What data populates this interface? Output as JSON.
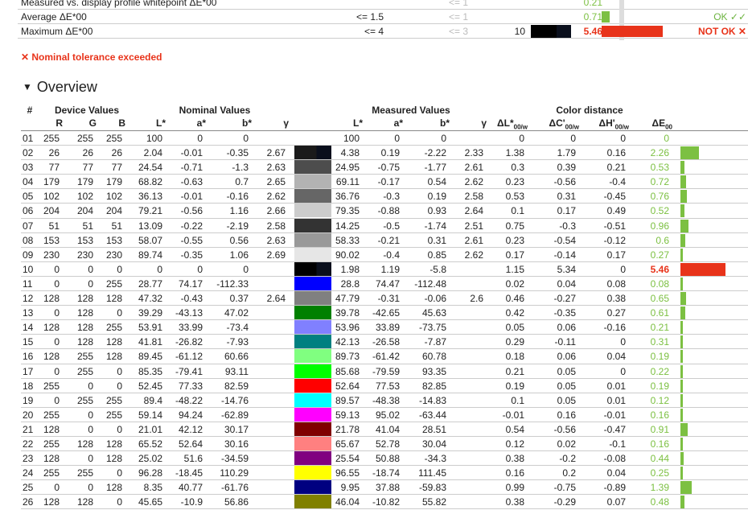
{
  "summary": [
    {
      "label": "Measured vs. display profile whitepoint ΔE*00",
      "nominal": "",
      "recommended": "<= 1",
      "value": "0.21",
      "status": "",
      "bad": false,
      "bar": 0,
      "sw_value": "",
      "sw_color": ""
    },
    {
      "label": "Average ΔE*00",
      "nominal": "<= 1.5",
      "recommended": "<= 1",
      "value": "0.71",
      "status": "OK ✓✓",
      "bad": false,
      "bar": 0.71,
      "sw_value": "",
      "sw_color": ""
    },
    {
      "label": "Maximum ΔE*00",
      "nominal": "<= 4",
      "recommended": "<= 3",
      "value": "5.46",
      "status": "NOT OK ✕",
      "bad": true,
      "bar": 5.46,
      "sw_value": "10",
      "sw_color": "#000000"
    }
  ],
  "warning": "✕ Nominal tolerance exceeded",
  "overview_title": "Overview",
  "headers": {
    "group": [
      "#",
      "Device Values",
      "Nominal Values",
      "Measured Values",
      "Color distance"
    ],
    "cols": [
      "R",
      "G",
      "B",
      "L*",
      "a*",
      "b*",
      "γ",
      "L*",
      "a*",
      "b*",
      "γ",
      "ΔL*00/w",
      "ΔC'00/w",
      "ΔH'00/w",
      "ΔE00"
    ]
  },
  "colors": {
    "good": "#7cc042",
    "bad": "#e8331a"
  },
  "rows": [
    {
      "id": "01",
      "r": "255",
      "g": "255",
      "b": "255",
      "nl": "100",
      "na": "0",
      "nb": "0",
      "ng": "",
      "ml": "100",
      "ma": "0",
      "mb": "0",
      "mg": "",
      "dl": "0",
      "dc": "0",
      "dh": "0",
      "de": "0",
      "color": "#ffffff"
    },
    {
      "id": "02",
      "r": "26",
      "g": "26",
      "b": "26",
      "nl": "2.04",
      "na": "-0.01",
      "nb": "-0.35",
      "ng": "2.67",
      "ml": "4.38",
      "ma": "0.19",
      "mb": "-2.22",
      "mg": "2.33",
      "dl": "1.38",
      "dc": "1.79",
      "dh": "0.16",
      "de": "2.26",
      "color": "#1a1a1a"
    },
    {
      "id": "03",
      "r": "77",
      "g": "77",
      "b": "77",
      "nl": "24.54",
      "na": "-0.71",
      "nb": "-1.3",
      "ng": "2.63",
      "ml": "24.95",
      "ma": "-0.75",
      "mb": "-1.77",
      "mg": "2.61",
      "dl": "0.3",
      "dc": "0.39",
      "dh": "0.21",
      "de": "0.53",
      "color": "#4d4d4d"
    },
    {
      "id": "04",
      "r": "179",
      "g": "179",
      "b": "179",
      "nl": "68.82",
      "na": "-0.63",
      "nb": "0.7",
      "ng": "2.65",
      "ml": "69.11",
      "ma": "-0.17",
      "mb": "0.54",
      "mg": "2.62",
      "dl": "0.23",
      "dc": "-0.56",
      "dh": "-0.4",
      "de": "0.72",
      "color": "#b3b3b3"
    },
    {
      "id": "05",
      "r": "102",
      "g": "102",
      "b": "102",
      "nl": "36.13",
      "na": "-0.01",
      "nb": "-0.16",
      "ng": "2.62",
      "ml": "36.76",
      "ma": "-0.3",
      "mb": "0.19",
      "mg": "2.58",
      "dl": "0.53",
      "dc": "0.31",
      "dh": "-0.45",
      "de": "0.76",
      "color": "#666666"
    },
    {
      "id": "06",
      "r": "204",
      "g": "204",
      "b": "204",
      "nl": "79.21",
      "na": "-0.56",
      "nb": "1.16",
      "ng": "2.66",
      "ml": "79.35",
      "ma": "-0.88",
      "mb": "0.93",
      "mg": "2.64",
      "dl": "0.1",
      "dc": "0.17",
      "dh": "0.49",
      "de": "0.52",
      "color": "#cccccc"
    },
    {
      "id": "07",
      "r": "51",
      "g": "51",
      "b": "51",
      "nl": "13.09",
      "na": "-0.22",
      "nb": "-2.19",
      "ng": "2.58",
      "ml": "14.25",
      "ma": "-0.5",
      "mb": "-1.74",
      "mg": "2.51",
      "dl": "0.75",
      "dc": "-0.3",
      "dh": "-0.51",
      "de": "0.96",
      "color": "#333333"
    },
    {
      "id": "08",
      "r": "153",
      "g": "153",
      "b": "153",
      "nl": "58.07",
      "na": "-0.55",
      "nb": "0.56",
      "ng": "2.63",
      "ml": "58.33",
      "ma": "-0.21",
      "mb": "0.31",
      "mg": "2.61",
      "dl": "0.23",
      "dc": "-0.54",
      "dh": "-0.12",
      "de": "0.6",
      "color": "#999999"
    },
    {
      "id": "09",
      "r": "230",
      "g": "230",
      "b": "230",
      "nl": "89.74",
      "na": "-0.35",
      "nb": "1.06",
      "ng": "2.69",
      "ml": "90.02",
      "ma": "-0.4",
      "mb": "0.85",
      "mg": "2.62",
      "dl": "0.17",
      "dc": "-0.14",
      "dh": "0.17",
      "de": "0.27",
      "color": "#e6e6e6"
    },
    {
      "id": "10",
      "r": "0",
      "g": "0",
      "b": "0",
      "nl": "0",
      "na": "0",
      "nb": "0",
      "ng": "",
      "ml": "1.98",
      "ma": "1.19",
      "mb": "-5.8",
      "mg": "",
      "dl": "1.15",
      "dc": "5.34",
      "dh": "0",
      "de": "5.46",
      "color": "#000000"
    },
    {
      "id": "11",
      "r": "0",
      "g": "0",
      "b": "255",
      "nl": "28.77",
      "na": "74.17",
      "nb": "-112.33",
      "ng": "",
      "ml": "28.8",
      "ma": "74.47",
      "mb": "-112.48",
      "mg": "",
      "dl": "0.02",
      "dc": "0.04",
      "dh": "0.08",
      "de": "0.08",
      "color": "#0000ff"
    },
    {
      "id": "12",
      "r": "128",
      "g": "128",
      "b": "128",
      "nl": "47.32",
      "na": "-0.43",
      "nb": "0.37",
      "ng": "2.64",
      "ml": "47.79",
      "ma": "-0.31",
      "mb": "-0.06",
      "mg": "2.6",
      "dl": "0.46",
      "dc": "-0.27",
      "dh": "0.38",
      "de": "0.65",
      "color": "#808080"
    },
    {
      "id": "13",
      "r": "0",
      "g": "128",
      "b": "0",
      "nl": "39.29",
      "na": "-43.13",
      "nb": "47.02",
      "ng": "",
      "ml": "39.78",
      "ma": "-42.65",
      "mb": "45.63",
      "mg": "",
      "dl": "0.42",
      "dc": "-0.35",
      "dh": "0.27",
      "de": "0.61",
      "color": "#008000"
    },
    {
      "id": "14",
      "r": "128",
      "g": "128",
      "b": "255",
      "nl": "53.91",
      "na": "33.99",
      "nb": "-73.4",
      "ng": "",
      "ml": "53.96",
      "ma": "33.89",
      "mb": "-73.75",
      "mg": "",
      "dl": "0.05",
      "dc": "0.06",
      "dh": "-0.16",
      "de": "0.21",
      "color": "#8080ff"
    },
    {
      "id": "15",
      "r": "0",
      "g": "128",
      "b": "128",
      "nl": "41.81",
      "na": "-26.82",
      "nb": "-7.93",
      "ng": "",
      "ml": "42.13",
      "ma": "-26.58",
      "mb": "-7.87",
      "mg": "",
      "dl": "0.29",
      "dc": "-0.11",
      "dh": "0",
      "de": "0.31",
      "color": "#008080"
    },
    {
      "id": "16",
      "r": "128",
      "g": "255",
      "b": "128",
      "nl": "89.45",
      "na": "-61.12",
      "nb": "60.66",
      "ng": "",
      "ml": "89.73",
      "ma": "-61.42",
      "mb": "60.78",
      "mg": "",
      "dl": "0.18",
      "dc": "0.06",
      "dh": "0.04",
      "de": "0.19",
      "color": "#80ff80"
    },
    {
      "id": "17",
      "r": "0",
      "g": "255",
      "b": "0",
      "nl": "85.35",
      "na": "-79.41",
      "nb": "93.11",
      "ng": "",
      "ml": "85.68",
      "ma": "-79.59",
      "mb": "93.35",
      "mg": "",
      "dl": "0.21",
      "dc": "0.05",
      "dh": "0",
      "de": "0.22",
      "color": "#00ff00"
    },
    {
      "id": "18",
      "r": "255",
      "g": "0",
      "b": "0",
      "nl": "52.45",
      "na": "77.33",
      "nb": "82.59",
      "ng": "",
      "ml": "52.64",
      "ma": "77.53",
      "mb": "82.85",
      "mg": "",
      "dl": "0.19",
      "dc": "0.05",
      "dh": "0.01",
      "de": "0.19",
      "color": "#ff0000"
    },
    {
      "id": "19",
      "r": "0",
      "g": "255",
      "b": "255",
      "nl": "89.4",
      "na": "-48.22",
      "nb": "-14.76",
      "ng": "",
      "ml": "89.57",
      "ma": "-48.38",
      "mb": "-14.83",
      "mg": "",
      "dl": "0.1",
      "dc": "0.05",
      "dh": "0.01",
      "de": "0.12",
      "color": "#00ffff"
    },
    {
      "id": "20",
      "r": "255",
      "g": "0",
      "b": "255",
      "nl": "59.14",
      "na": "94.24",
      "nb": "-62.89",
      "ng": "",
      "ml": "59.13",
      "ma": "95.02",
      "mb": "-63.44",
      "mg": "",
      "dl": "-0.01",
      "dc": "0.16",
      "dh": "-0.01",
      "de": "0.16",
      "color": "#ff00ff"
    },
    {
      "id": "21",
      "r": "128",
      "g": "0",
      "b": "0",
      "nl": "21.01",
      "na": "42.12",
      "nb": "30.17",
      "ng": "",
      "ml": "21.78",
      "ma": "41.04",
      "mb": "28.51",
      "mg": "",
      "dl": "0.54",
      "dc": "-0.56",
      "dh": "-0.47",
      "de": "0.91",
      "color": "#800000"
    },
    {
      "id": "22",
      "r": "255",
      "g": "128",
      "b": "128",
      "nl": "65.52",
      "na": "52.64",
      "nb": "30.16",
      "ng": "",
      "ml": "65.67",
      "ma": "52.78",
      "mb": "30.04",
      "mg": "",
      "dl": "0.12",
      "dc": "0.02",
      "dh": "-0.1",
      "de": "0.16",
      "color": "#ff8080"
    },
    {
      "id": "23",
      "r": "128",
      "g": "0",
      "b": "128",
      "nl": "25.02",
      "na": "51.6",
      "nb": "-34.59",
      "ng": "",
      "ml": "25.54",
      "ma": "50.88",
      "mb": "-34.3",
      "mg": "",
      "dl": "0.38",
      "dc": "-0.2",
      "dh": "-0.08",
      "de": "0.44",
      "color": "#800080"
    },
    {
      "id": "24",
      "r": "255",
      "g": "255",
      "b": "0",
      "nl": "96.28",
      "na": "-18.45",
      "nb": "110.29",
      "ng": "",
      "ml": "96.55",
      "ma": "-18.74",
      "mb": "111.45",
      "mg": "",
      "dl": "0.16",
      "dc": "0.2",
      "dh": "0.04",
      "de": "0.25",
      "color": "#ffff00"
    },
    {
      "id": "25",
      "r": "0",
      "g": "0",
      "b": "128",
      "nl": "8.35",
      "na": "40.77",
      "nb": "-61.76",
      "ng": "",
      "ml": "9.95",
      "ma": "37.88",
      "mb": "-59.83",
      "mg": "",
      "dl": "0.99",
      "dc": "-0.75",
      "dh": "-0.89",
      "de": "1.39",
      "color": "#000080"
    },
    {
      "id": "26",
      "r": "128",
      "g": "128",
      "b": "0",
      "nl": "45.65",
      "na": "-10.9",
      "nb": "56.86",
      "ng": "",
      "ml": "46.04",
      "ma": "-10.82",
      "mb": "55.82",
      "mg": "",
      "dl": "0.38",
      "dc": "-0.29",
      "dh": "0.07",
      "de": "0.48",
      "color": "#808000"
    }
  ]
}
